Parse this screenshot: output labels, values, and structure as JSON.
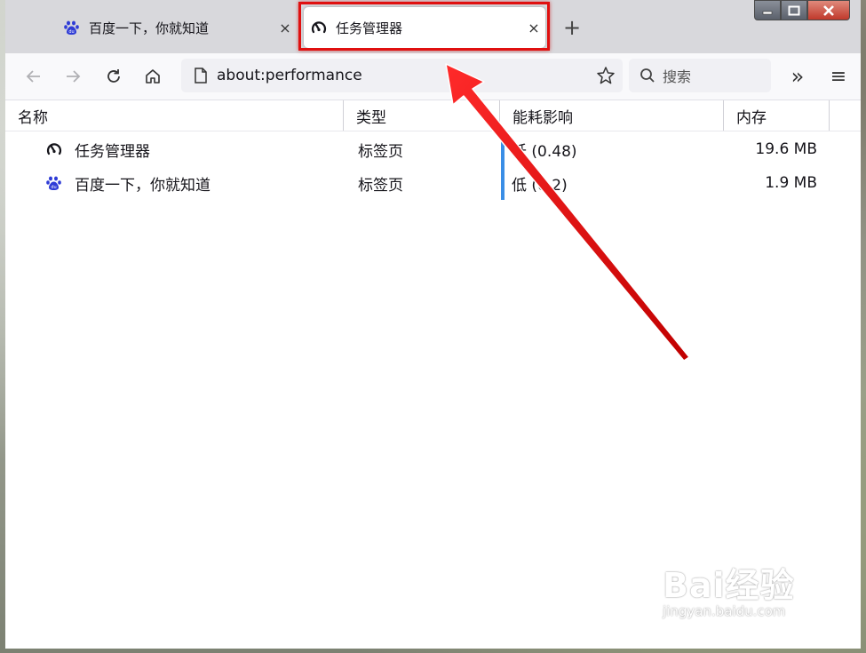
{
  "tabs": [
    {
      "label": "百度一下，你就知道",
      "icon": "baidu-paw-icon",
      "close": "×"
    },
    {
      "label": "任务管理器",
      "icon": "gauge-icon",
      "close": "×"
    }
  ],
  "new_tab": "+",
  "nav": {
    "url": "about:performance",
    "search_placeholder": "搜索",
    "overflow": "»",
    "menu": "≡"
  },
  "table": {
    "headers": [
      "名称",
      "类型",
      "能耗影响",
      "内存"
    ],
    "rows": [
      {
        "name": "任务管理器",
        "icon": "gauge-icon",
        "type": "标签页",
        "energy": "低 (0.48)",
        "memory": "19.6 MB"
      },
      {
        "name": "百度一下，你就知道",
        "icon": "baidu-paw-icon",
        "type": "标签页",
        "energy": "低 (0.2)",
        "memory": "1.9 MB"
      }
    ]
  },
  "watermark": {
    "brand": "Bai经验",
    "url": "jingyan.baidu.com"
  },
  "colors": {
    "highlight": "#e01010",
    "energy_bar": "#3a8ee6",
    "baidu_blue": "#2f3cd6"
  }
}
